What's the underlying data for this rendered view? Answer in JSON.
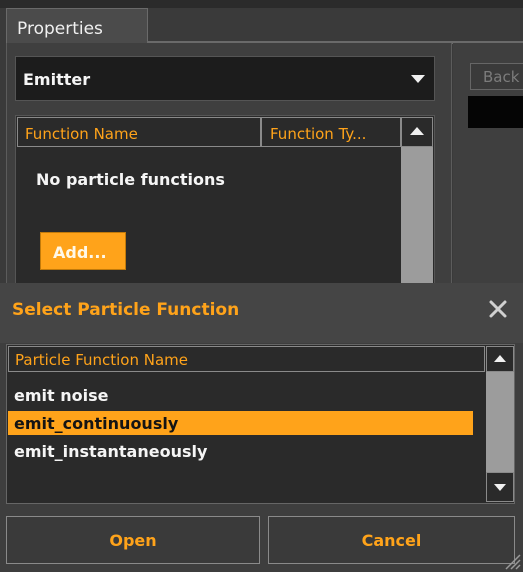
{
  "properties_panel": {
    "tab_label": "Properties",
    "dropdown": {
      "value": "Emitter"
    },
    "table": {
      "columns": [
        "Function Name",
        "Function Ty..."
      ],
      "empty_message": "No particle functions"
    },
    "add_button_label": "Add..."
  },
  "right_panel": {
    "back_button_label": "Back"
  },
  "dialog": {
    "title": "Select Particle Function",
    "list_header": "Particle Function Name",
    "items": [
      "emit noise",
      "emit_continuously",
      "emit_instantaneously"
    ],
    "selected_index": 1,
    "open_label": "Open",
    "cancel_label": "Cancel"
  },
  "colors": {
    "accent": "#ffa31a",
    "background": "#3a3a3a",
    "list_background": "#2a2a2a"
  },
  "icons": [
    "dropdown-caret-icon",
    "scroll-up-icon",
    "scroll-down-icon",
    "close-icon",
    "resize-grip-icon"
  ]
}
